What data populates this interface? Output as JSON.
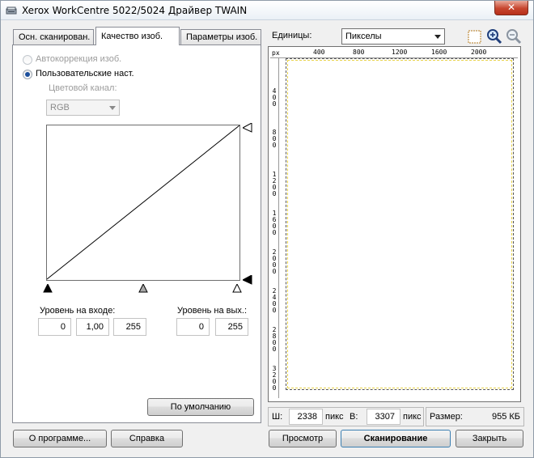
{
  "window": {
    "title": "Xerox WorkCentre 5022/5024 Драйвер TWAIN",
    "close_symbol": "✕"
  },
  "tabs": [
    {
      "label": "Осн. сканирован.",
      "active": false
    },
    {
      "label": "Качество изоб.",
      "active": true
    },
    {
      "label": "Параметры изоб.",
      "active": false
    }
  ],
  "quality": {
    "auto_correction_label": "Автокоррекция изоб.",
    "custom_label": "Пользовательские наст.",
    "channel_label": "Цветовой канал:",
    "channel_value": "RGB",
    "input_level_label": "Уровень на входе:",
    "input_level_values": [
      "0",
      "1,00",
      "255"
    ],
    "output_level_label": "Уровень на вых.:",
    "output_level_values": [
      "0",
      "255"
    ],
    "default_button": "По умолчанию"
  },
  "units": {
    "label": "Единицы:",
    "value": "Пикселы"
  },
  "ruler": {
    "corner": "px",
    "top_ticks": [
      "400",
      "800",
      "1200",
      "1600",
      "2000"
    ],
    "left_ticks": [
      "400",
      "800",
      "1200",
      "1600",
      "2000",
      "2400",
      "2800",
      "3200"
    ]
  },
  "size_bar": {
    "width_label": "Ш:",
    "width_value": "2338",
    "width_unit": "пикс",
    "height_label": "В:",
    "height_value": "3307",
    "height_unit": "пикс",
    "size_label": "Размер:",
    "size_value": "955 КБ"
  },
  "buttons": {
    "about": "О программе...",
    "help": "Справка",
    "preview": "Просмотр",
    "scan": "Сканирование",
    "close": "Закрыть"
  },
  "icons": {
    "select": "select-area-icon",
    "zoom_in": "zoom-in-icon",
    "zoom_out": "zoom-out-icon"
  },
  "colors": {
    "accent": "#1b4f9c",
    "scan_border": "#e8d24a",
    "close_button": "#c7462f"
  }
}
